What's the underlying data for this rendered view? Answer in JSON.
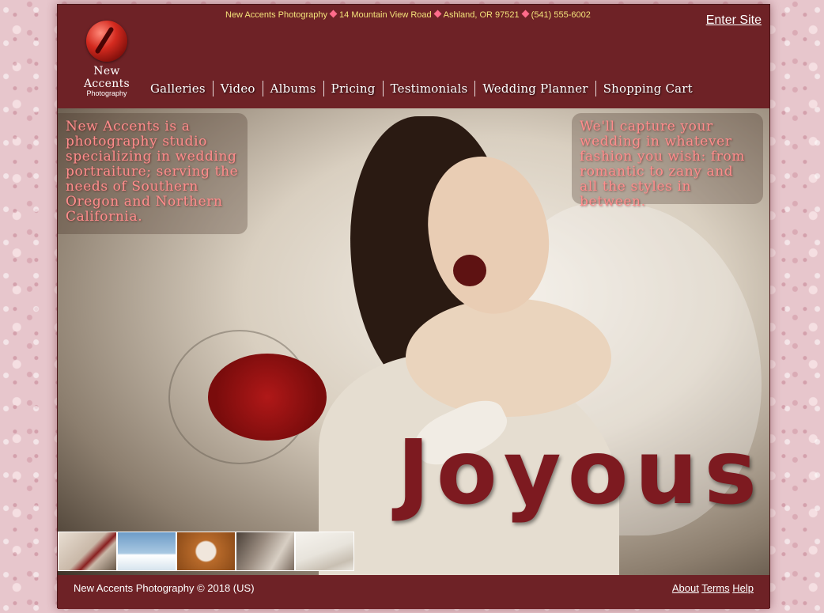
{
  "top_info": {
    "studio": "New Accents Photography",
    "street": "14 Mountain View Road",
    "city": "Ashland, OR 97521",
    "phone": "(541) 555-6002"
  },
  "enter_site": "Enter Site",
  "logo": {
    "name": "New Accents",
    "sub": "Photography"
  },
  "nav": [
    "Galleries",
    "Video",
    "Albums",
    "Pricing",
    "Testimonials",
    "Wedding Planner",
    "Shopping Cart"
  ],
  "hero": {
    "intro": "New Accents is a photography studio specializing in wedding portraiture; serving the needs of Southern Oregon and Northern California.",
    "tagline": "We'll capture your wedding in whatever fashion you wish: from romantic to zany and all the styles in between.",
    "headline": "Joyous"
  },
  "thumbnails": [
    {
      "icon": "bride-bouquet-thumbnail",
      "color": "#c9b8a8"
    },
    {
      "icon": "couple-railing-thumbnail",
      "color": "#8fb4d4"
    },
    {
      "icon": "couple-leaves-thumbnail",
      "color": "#b86a2a"
    },
    {
      "icon": "couple-embrace-thumbnail",
      "color": "#9a8c80"
    },
    {
      "icon": "bride-lounging-thumbnail",
      "color": "#e8e4dc"
    }
  ],
  "footer": {
    "copyright": "New Accents Photography © 2018 (US)",
    "links": [
      "About",
      "Terms",
      "Help"
    ]
  },
  "colors": {
    "frame": "#6e2226",
    "info_text": "#f3e27a",
    "hero_text": "#ff8c8c",
    "headline": "#7d1a20",
    "diamond": "#ff6b8a"
  }
}
